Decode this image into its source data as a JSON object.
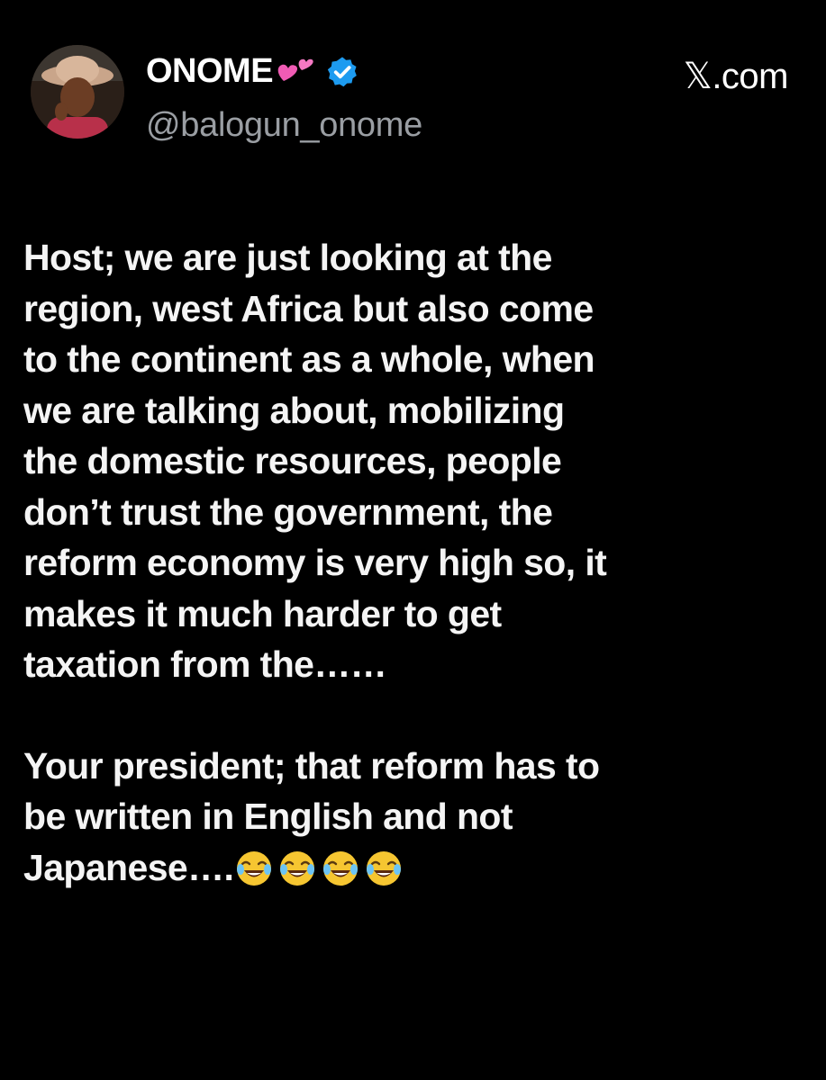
{
  "author": {
    "display_name": "ONOME",
    "handle": "@balogun_onome",
    "verified": true,
    "name_emoji": "two-hearts-icon"
  },
  "site_label": "𝕏.com",
  "tweet": {
    "paragraph_1_lines": [
      "Host; we are just looking at the",
      "region, west Africa but also come",
      "to the continent as a whole, when",
      "we are talking about, mobilizing",
      "the domestic resources, people",
      "don’t trust the government, the",
      "reform economy is very high so, it",
      "makes it much harder to get",
      "taxation from the……"
    ],
    "paragraph_2_lines": [
      "Your president; that reform has to",
      "be written in English and not",
      "Japanese…."
    ],
    "trailing_emojis": [
      "face-with-tears-of-joy-icon",
      "face-with-tears-of-joy-icon",
      "face-with-tears-of-joy-icon",
      "face-with-tears-of-joy-icon"
    ]
  },
  "colors": {
    "background": "#000000",
    "text": "#f4f4f4",
    "handle": "#9a9ea3",
    "verified_badge": "#1d9bf0",
    "hearts": "#f05bb4"
  }
}
